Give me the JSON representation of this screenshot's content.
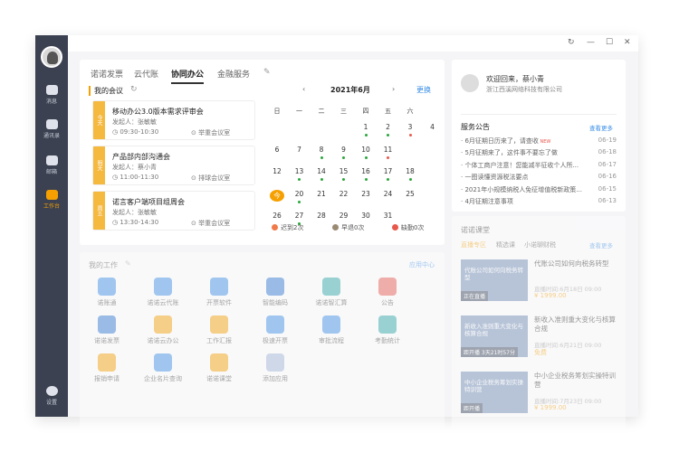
{
  "sidebar": {
    "items": [
      {
        "label": "消息"
      },
      {
        "label": "通讯录"
      },
      {
        "label": "邮箱"
      },
      {
        "label": "工作台"
      },
      {
        "label": "设置"
      }
    ]
  },
  "tabs": [
    "诺诺发票",
    "云代账",
    "协同办公",
    "金融服务"
  ],
  "meetings": {
    "title": "我的会议",
    "items": [
      {
        "day": "今天",
        "title": "移动办公3.0版本需求评审会",
        "sponsor": "发起人：张敏敏",
        "time": "09:30-10:30",
        "room": "举重会议室"
      },
      {
        "day": "明天",
        "title": "产品部内部沟通会",
        "sponsor": "发起人：蔡小青",
        "time": "11:00-11:30",
        "room": "排球会议室"
      },
      {
        "day": "周五",
        "title": "诺言客户端项目组周会",
        "sponsor": "发起人：张敏敏",
        "time": "13:30-14:30",
        "room": "举重会议室"
      }
    ]
  },
  "calendar": {
    "month": "2021年6月",
    "change": "更换",
    "weekdays": [
      "日",
      "一",
      "二",
      "三",
      "四",
      "五",
      "六"
    ],
    "rows": [
      [
        "",
        "",
        "1",
        "2",
        "3",
        "4"
      ],
      [
        "6",
        "7",
        "8",
        "9",
        "10",
        "11"
      ],
      [
        "12",
        "13",
        "14",
        "15",
        "16",
        "17",
        "18"
      ],
      [
        "今",
        "20",
        "21",
        "22",
        "23",
        "24",
        "25"
      ],
      [
        "26",
        "27",
        "28",
        "29",
        "30",
        "31"
      ]
    ],
    "legend": [
      "迟到2次",
      "早退0次",
      "缺勤0次"
    ]
  },
  "welcome": {
    "greeting": "欢迎回来，蔡小青",
    "company": "浙江西溪网络科技有限公司"
  },
  "announce": {
    "title": "服务公告",
    "more": "查看更多",
    "new_badge": "NEW",
    "items": [
      {
        "text": "6月征期日历来了，请查收",
        "date": "06-19",
        "isnew": true
      },
      {
        "text": "5月征期来了，这件事不要忘了做",
        "date": "06-18"
      },
      {
        "text": "个体工商户注意！您能减半征收个人所...",
        "date": "06-17"
      },
      {
        "text": "一图读懂资源税法要点",
        "date": "06-16"
      },
      {
        "text": "2021年小规模纳税人免征增值税新政策...",
        "date": "06-15"
      },
      {
        "text": "4月征期注意事项",
        "date": "06-13"
      }
    ]
  },
  "work": {
    "title": "我的工作",
    "center": "应用中心",
    "apps": [
      "诺账通",
      "诺诺云代账",
      "开票软件",
      "智能编码",
      "诺诺智汇算",
      "公告",
      "诺诺发票",
      "诺诺云办公",
      "工作汇报",
      "极速开票",
      "审批流程",
      "考勤统计",
      "报销申请",
      "企业名片查询",
      "诺诺课堂",
      "添加应用"
    ]
  },
  "class": {
    "title": "诺诺课堂",
    "tabs": [
      "直播专区",
      "精选课",
      "小诺聊财税"
    ],
    "more": "查看更多",
    "items": [
      {
        "title": "代账公司如何向税务转型",
        "date": "直播时间:6月18日 09:00",
        "price": "¥ 1999.00",
        "thumb": "代账公司如何向税务转型",
        "status": "正在直播"
      },
      {
        "title": "新收入准则重大变化与核算合规",
        "date": "直播时间:6月21日 09:00",
        "price": "免费",
        "thumb": "新收入准则重大变化与核算合规",
        "status": "距开播 3天21时57分"
      },
      {
        "title": "中小企业税务筹划实操特训营",
        "date": "直播时间:7月23日 09:00",
        "price": "¥ 1999.00",
        "thumb": "中小企业税务筹划实操特训营",
        "status": "距开播"
      }
    ]
  }
}
